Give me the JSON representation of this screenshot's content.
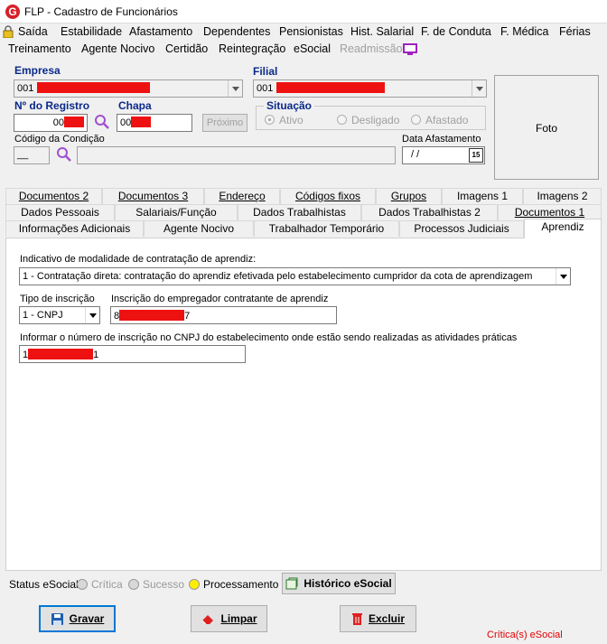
{
  "window": {
    "title": "FLP - Cadastro de Funcionários",
    "logo": "G"
  },
  "menu_row1": [
    "Saída",
    "Estabilidade",
    "Afastamento",
    "Dependentes",
    "Pensionistas",
    "Hist. Salarial",
    "F. de Conduta",
    "F. Médica",
    "Férias"
  ],
  "menu_row2": [
    "Treinamento",
    "Agente Nocivo",
    "Certidão",
    "Reintegração",
    "eSocial",
    "Readmissão"
  ],
  "empresa": {
    "label": "Empresa",
    "value": "001"
  },
  "filial": {
    "label": "Filial",
    "value": "001"
  },
  "registro": {
    "label": "Nº do Registro",
    "value": "00"
  },
  "chapa": {
    "label": "Chapa",
    "value": "00"
  },
  "proximo_label": "Próximo",
  "situacao": {
    "label": "Situação",
    "options": [
      "Ativo",
      "Desligado",
      "Afastado"
    ],
    "selected": "Ativo"
  },
  "condicao": {
    "label": "Código da Condição",
    "value": "__"
  },
  "afastamento": {
    "label": "Data Afastamento",
    "value": "/ /",
    "calendar_day": "15"
  },
  "foto_label": "Foto",
  "tabs_row1": [
    "Documentos 2",
    "Documentos 3",
    "Endereço",
    "Códigos fixos",
    "Grupos",
    "Imagens 1",
    "Imagens 2"
  ],
  "tabs_row2": [
    "Dados Pessoais",
    "Salariais/Função",
    "Dados Trabalhistas",
    "Dados Trabalhistas 2",
    "Documentos 1"
  ],
  "tabs_row3": [
    "Informações Adicionais",
    "Agente Nocivo",
    "Trabalhador Temporário",
    "Processos Judiciais",
    "Aprendiz"
  ],
  "active_tab": "Aprendiz",
  "aprendiz": {
    "modalidade_label": "Indicativo de modalidade de contratação de aprendiz:",
    "modalidade_value": "1 - Contratação direta: contratação do aprendiz efetivada pelo estabelecimento cumpridor da cota de aprendizagem",
    "tipo_label": "Tipo de inscrição",
    "tipo_value": "1 - CNPJ",
    "inscricao_label": "Inscrição do empregador contratante de aprendiz",
    "inscricao_start": "8",
    "inscricao_end": "7",
    "cnpj_label": "Informar o número de inscrição no CNPJ do estabelecimento onde estão sendo realizadas as atividades práticas",
    "cnpj_start": "1",
    "cnpj_end": "1"
  },
  "status": {
    "label": "Status eSocial:",
    "items": [
      {
        "label": "Crítica",
        "color": "#d8d8d8"
      },
      {
        "label": "Sucesso",
        "color": "#d8d8d8"
      },
      {
        "label": "Processamento",
        "color": "#ffee00"
      }
    ],
    "historico_label": "Histórico eSocial"
  },
  "buttons": {
    "gravar": "Gravar",
    "limpar": "Limpar",
    "excluir": "Excluir"
  },
  "critica_label": "Crítica(s) eSocial",
  "colors": {
    "accent_label": "#0a2a8a",
    "redaction": "#ee1111",
    "critica": "#e00000"
  }
}
